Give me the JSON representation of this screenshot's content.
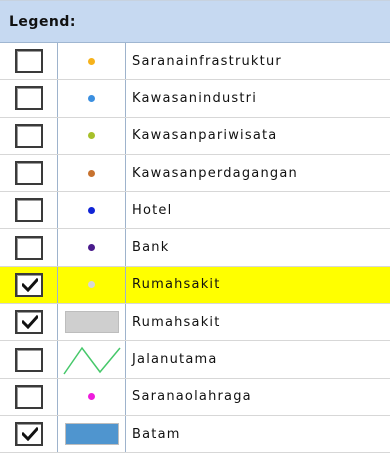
{
  "legend": {
    "title": "Legend:",
    "items": [
      {
        "label": "Saranainfrastruktur",
        "checked": false,
        "symbol": "dot",
        "color": "#f6b21b",
        "highlight": false
      },
      {
        "label": "Kawasanindustri",
        "checked": false,
        "symbol": "dot",
        "color": "#3b8fe0",
        "highlight": false
      },
      {
        "label": "Kawasanpariwisata",
        "checked": false,
        "symbol": "dot",
        "color": "#a7c02a",
        "highlight": false
      },
      {
        "label": "Kawasanperdagangan",
        "checked": false,
        "symbol": "dot",
        "color": "#c7722f",
        "highlight": false
      },
      {
        "label": "Hotel",
        "checked": false,
        "symbol": "dot",
        "color": "#1024d6",
        "highlight": false
      },
      {
        "label": "Bank",
        "checked": false,
        "symbol": "dot",
        "color": "#4a1b8c",
        "highlight": false
      },
      {
        "label": "Rumahsakit",
        "checked": true,
        "symbol": "dot",
        "color": "#d8d8d8",
        "highlight": true
      },
      {
        "label": "Rumahsakit",
        "checked": true,
        "symbol": "rect",
        "color": "#cfcfcf",
        "highlight": false
      },
      {
        "label": "Jalanutama",
        "checked": false,
        "symbol": "line",
        "color": "#46c86a",
        "highlight": false
      },
      {
        "label": "Saranaolahraga",
        "checked": false,
        "symbol": "dot",
        "color": "#ee1cdc",
        "highlight": false
      },
      {
        "label": "Batam",
        "checked": true,
        "symbol": "rect",
        "color": "#4f95cf",
        "highlight": false
      }
    ]
  }
}
